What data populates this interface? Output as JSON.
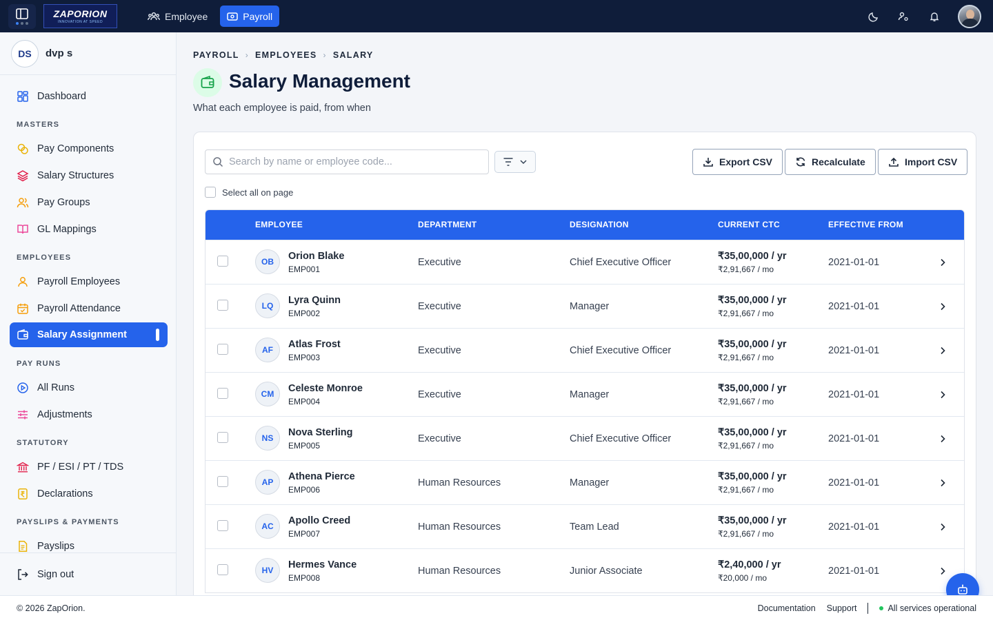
{
  "colors": {
    "topbar": "#0f1d3a",
    "accent": "#2563eb",
    "status_ok": "#22c55e"
  },
  "topbar": {
    "logo": {
      "name": "ZAPORION",
      "tagline": "INNOVATION AT SPEED"
    },
    "nav": [
      {
        "label": "Employee",
        "icon": "users-icon",
        "active": false
      },
      {
        "label": "Payroll",
        "icon": "wallet-icon",
        "active": true
      }
    ],
    "right_icons": [
      "moon-icon",
      "user-settings-icon",
      "bell-icon",
      "avatar"
    ]
  },
  "sidebar": {
    "user": {
      "initials": "DS",
      "name": "dvp s"
    },
    "dashboard": {
      "label": "Dashboard",
      "icon": "dashboard-icon"
    },
    "sections": [
      {
        "title": "MASTERS",
        "items": [
          {
            "label": "Pay Components",
            "icon": "coins-icon"
          },
          {
            "label": "Salary Structures",
            "icon": "layers-icon"
          },
          {
            "label": "Pay Groups",
            "icon": "users-icon"
          },
          {
            "label": "GL Mappings",
            "icon": "book-icon"
          }
        ]
      },
      {
        "title": "EMPLOYEES",
        "items": [
          {
            "label": "Payroll Employees",
            "icon": "user-icon"
          },
          {
            "label": "Payroll Attendance",
            "icon": "calendar-icon"
          },
          {
            "label": "Salary Assignment",
            "icon": "wallet-icon",
            "active": true
          }
        ]
      },
      {
        "title": "PAY RUNS",
        "items": [
          {
            "label": "All Runs",
            "icon": "play-circle-icon"
          },
          {
            "label": "Adjustments",
            "icon": "sliders-icon"
          }
        ]
      },
      {
        "title": "STATUTORY",
        "items": [
          {
            "label": "PF / ESI / PT / TDS",
            "icon": "bank-icon"
          },
          {
            "label": "Declarations",
            "icon": "rupee-doc-icon"
          }
        ]
      },
      {
        "title": "PAYSLIPS & PAYMENTS",
        "items": [
          {
            "label": "Payslips",
            "icon": "document-icon"
          }
        ]
      }
    ],
    "signout": "Sign out"
  },
  "main": {
    "breadcrumb": [
      "PAYROLL",
      "EMPLOYEES",
      "SALARY"
    ],
    "title": "Salary Management",
    "subtitle": "What each employee is paid, from when",
    "search_placeholder": "Search by name or employee code...",
    "buttons": {
      "export": "Export CSV",
      "recalculate": "Recalculate",
      "import": "Import CSV"
    },
    "select_all": "Select all on page",
    "columns": [
      "EMPLOYEE",
      "DEPARTMENT",
      "DESIGNATION",
      "CURRENT CTC",
      "EFFECTIVE FROM"
    ],
    "rows": [
      {
        "initials": "OB",
        "name": "Orion Blake",
        "code": "EMP001",
        "department": "Executive",
        "designation": "Chief Executive Officer",
        "ctc": "₹35,00,000 / yr",
        "monthly": "₹2,91,667 / mo",
        "effective": "2021-01-01"
      },
      {
        "initials": "LQ",
        "name": "Lyra Quinn",
        "code": "EMP002",
        "department": "Executive",
        "designation": "Manager",
        "ctc": "₹35,00,000 / yr",
        "monthly": "₹2,91,667 / mo",
        "effective": "2021-01-01"
      },
      {
        "initials": "AF",
        "name": "Atlas Frost",
        "code": "EMP003",
        "department": "Executive",
        "designation": "Chief Executive Officer",
        "ctc": "₹35,00,000 / yr",
        "monthly": "₹2,91,667 / mo",
        "effective": "2021-01-01"
      },
      {
        "initials": "CM",
        "name": "Celeste Monroe",
        "code": "EMP004",
        "department": "Executive",
        "designation": "Manager",
        "ctc": "₹35,00,000 / yr",
        "monthly": "₹2,91,667 / mo",
        "effective": "2021-01-01"
      },
      {
        "initials": "NS",
        "name": "Nova Sterling",
        "code": "EMP005",
        "department": "Executive",
        "designation": "Chief Executive Officer",
        "ctc": "₹35,00,000 / yr",
        "monthly": "₹2,91,667 / mo",
        "effective": "2021-01-01"
      },
      {
        "initials": "AP",
        "name": "Athena Pierce",
        "code": "EMP006",
        "department": "Human Resources",
        "designation": "Manager",
        "ctc": "₹35,00,000 / yr",
        "monthly": "₹2,91,667 / mo",
        "effective": "2021-01-01"
      },
      {
        "initials": "AC",
        "name": "Apollo Creed",
        "code": "EMP007",
        "department": "Human Resources",
        "designation": "Team Lead",
        "ctc": "₹35,00,000 / yr",
        "monthly": "₹2,91,667 / mo",
        "effective": "2021-01-01"
      },
      {
        "initials": "HV",
        "name": "Hermes Vance",
        "code": "EMP008",
        "department": "Human Resources",
        "designation": "Junior Associate",
        "ctc": "₹2,40,000 / yr",
        "monthly": "₹20,000 / mo",
        "effective": "2021-01-01"
      }
    ]
  },
  "footer": {
    "copyright": "© 2026 ZapOrion.",
    "documentation": "Documentation",
    "support": "Support",
    "status": "All services operational"
  }
}
